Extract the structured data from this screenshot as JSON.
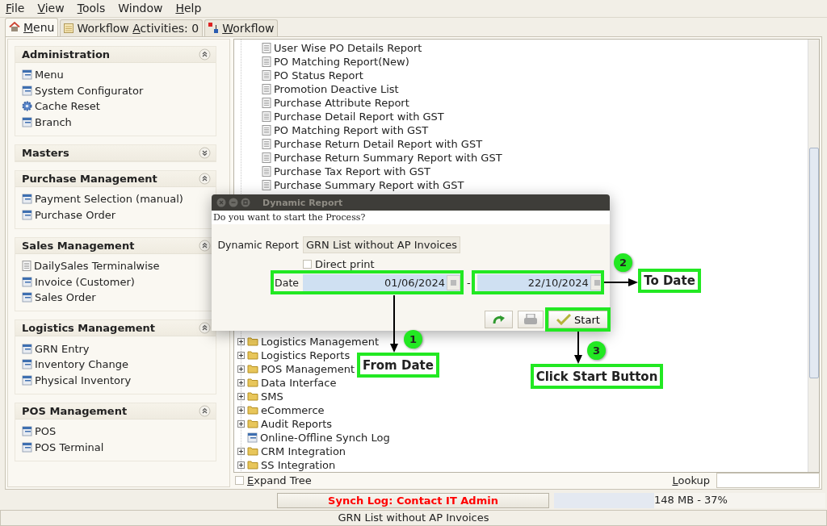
{
  "menu_bar": [
    {
      "label": "File"
    },
    {
      "label": "View"
    },
    {
      "label": "Tools"
    },
    {
      "label": "Window"
    },
    {
      "label": "Help"
    }
  ],
  "tabs": [
    {
      "label": "Menu",
      "selected": true,
      "kind": "home"
    },
    {
      "label": "Workflow Activities: 0",
      "selected": false,
      "kind": "activities"
    },
    {
      "label": "Workflow",
      "selected": false,
      "kind": "workflow"
    }
  ],
  "sections": [
    {
      "title": "Administration",
      "expanded": true,
      "items": [
        {
          "label": "Menu",
          "kind": "window"
        },
        {
          "label": "System Configurator",
          "kind": "window"
        },
        {
          "label": "Cache Reset",
          "kind": "process"
        },
        {
          "label": "Branch",
          "kind": "window"
        }
      ]
    },
    {
      "title": "Masters",
      "expanded": false
    },
    {
      "title": "Purchase Management",
      "expanded": true,
      "items": [
        {
          "label": "Payment Selection (manual)",
          "kind": "window"
        },
        {
          "label": "Purchase Order",
          "kind": "window"
        }
      ]
    },
    {
      "title": "Sales Management",
      "expanded": true,
      "items": [
        {
          "label": "DailySales Terminalwise",
          "kind": "report"
        },
        {
          "label": "Invoice (Customer)",
          "kind": "window"
        },
        {
          "label": "Sales Order",
          "kind": "window"
        }
      ]
    },
    {
      "title": "Logistics Management",
      "expanded": true,
      "items": [
        {
          "label": "GRN Entry",
          "kind": "window"
        },
        {
          "label": "Inventory Change",
          "kind": "window"
        },
        {
          "label": "Physical Inventory",
          "kind": "window"
        }
      ]
    },
    {
      "title": "POS Management",
      "expanded": true,
      "items": [
        {
          "label": "POS",
          "kind": "window"
        },
        {
          "label": "POS Terminal",
          "kind": "window"
        }
      ]
    }
  ],
  "tree": {
    "rows_top": [
      {
        "label": "User Wise PO Details Report",
        "kind": "report"
      },
      {
        "label": "PO Matching Report(New)",
        "kind": "report"
      },
      {
        "label": "PO Status Report",
        "kind": "report"
      },
      {
        "label": "Promotion Deactive List",
        "kind": "report"
      },
      {
        "label": "Purchase Attribute Report",
        "kind": "report"
      },
      {
        "label": "Purchase Detail Report with GST",
        "kind": "report"
      },
      {
        "label": "PO Matching Report with GST",
        "kind": "report"
      },
      {
        "label": "Purchase Return Detail Report with GST",
        "kind": "report"
      },
      {
        "label": "Purchase Return Summary Report with GST",
        "kind": "report"
      },
      {
        "label": "Purchase Tax Report with GST",
        "kind": "report"
      },
      {
        "label": "Purchase Summary Report with GST",
        "kind": "report"
      }
    ],
    "rows_bottom": [
      {
        "label": "Logistics Management",
        "kind": "folder",
        "expanded": false
      },
      {
        "label": "Logistics Reports",
        "kind": "folder",
        "expanded": false
      },
      {
        "label": "POS Management",
        "kind": "folder",
        "expanded": false
      },
      {
        "label": "Data Interface",
        "kind": "folder",
        "expanded": false
      },
      {
        "label": "SMS",
        "kind": "folder",
        "expanded": false
      },
      {
        "label": "eCommerce",
        "kind": "folder",
        "expanded": false
      },
      {
        "label": "Audit Reports",
        "kind": "folder",
        "expanded": false
      },
      {
        "label": "Online-Offline Synch Log",
        "kind": "window"
      },
      {
        "label": "CRM Integration",
        "kind": "folder",
        "expanded": false
      },
      {
        "label": "SS Integration",
        "kind": "folder",
        "expanded": false
      }
    ],
    "expand_tree": {
      "label": "Expand Tree",
      "checked": false
    },
    "lookup": {
      "label": "Lookup"
    }
  },
  "status": {
    "message": "Synch Log: Contact IT Admin",
    "memory": {
      "reading": "148 MB - 37%",
      "level": 0.37
    },
    "footer": "GRN List without AP Invoices"
  },
  "dialog": {
    "title": "Dynamic Report",
    "question": "Do you want to start the Process?",
    "report_label": "Dynamic Report",
    "report_value": "GRN List without AP Invoices",
    "direct_print": {
      "label": "Direct print",
      "checked": false
    },
    "date_label": "Date",
    "date_from": "01/06/2024",
    "separator": "-",
    "date_to": "22/10/2024",
    "start_label": "Start"
  },
  "annotations": [
    {
      "number": "1",
      "label": "From Date"
    },
    {
      "number": "2",
      "label": "To Date"
    },
    {
      "number": "3",
      "label": "Click Start Button"
    }
  ]
}
